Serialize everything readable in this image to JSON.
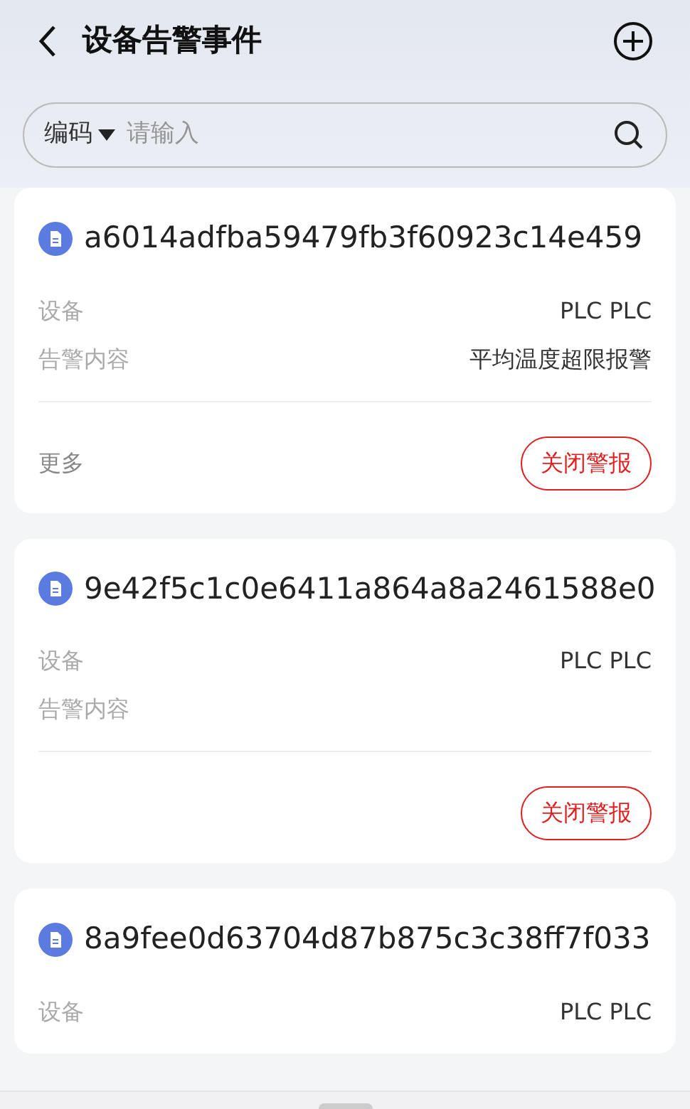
{
  "header": {
    "title": "设备告警事件"
  },
  "search": {
    "filter": "编码",
    "placeholder": "请输入"
  },
  "cards": [
    {
      "code": "a6014adfba59479fb3f60923c14e459",
      "rows": [
        {
          "label": "设备",
          "value": "PLC PLC"
        },
        {
          "label": "告警内容",
          "value": "平均温度超限报警"
        }
      ],
      "more": "更多",
      "action": "关闭警报"
    },
    {
      "code": "9e42f5c1c0e6411a864a8a2461588e0",
      "rows": [
        {
          "label": "设备",
          "value": "PLC PLC"
        },
        {
          "label": "告警内容"
        }
      ],
      "action": "关闭警报"
    },
    {
      "code": "8a9fee0d63704d87b875c3c38ff7f033",
      "rows": [
        {
          "label": "设备",
          "value": "PLC PLC"
        }
      ]
    }
  ]
}
